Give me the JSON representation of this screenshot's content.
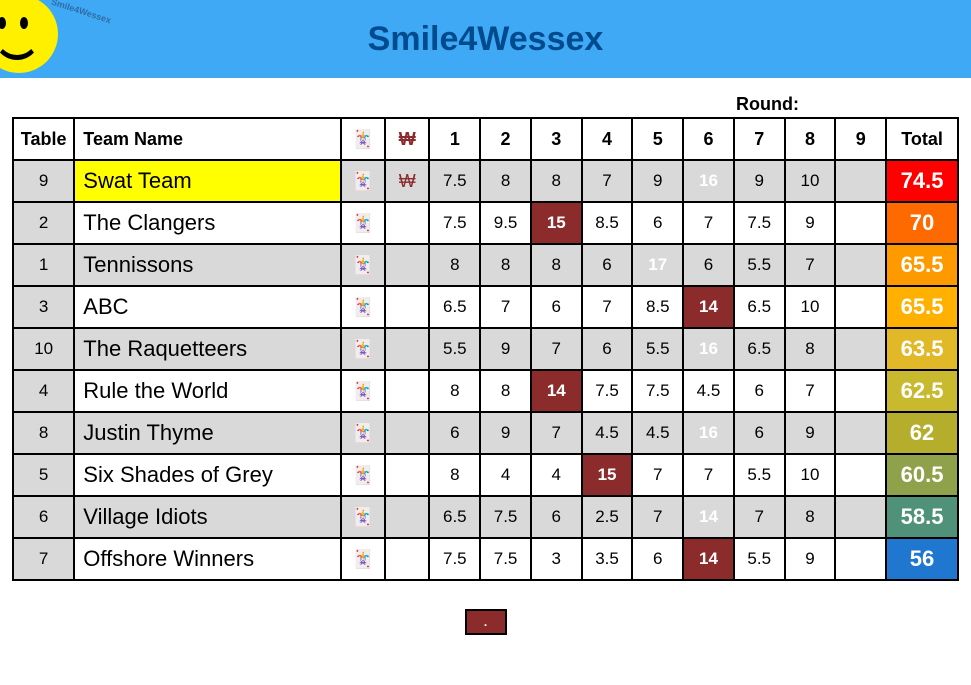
{
  "title": "Smile4Wessex",
  "logo_text": "Smile4Wessex",
  "round_label": "Round:",
  "joker_icon": "🃏",
  "wager_icon": "₩",
  "legend_text": ".",
  "headers": {
    "table": "Table",
    "name": "Team Name",
    "total": "Total"
  },
  "round_headers": [
    "1",
    "2",
    "3",
    "4",
    "5",
    "6",
    "7",
    "8",
    "9"
  ],
  "total_colors": [
    "#ff0000",
    "#ff6a00",
    "#ff9900",
    "#ffb000",
    "#e0b828",
    "#c9b92e",
    "#b5ad2c",
    "#8fa14a",
    "#4f9279",
    "#1f77d0"
  ],
  "rows": [
    {
      "table": "9",
      "name": "Swat Team",
      "wager": true,
      "joker_round": 6,
      "leader": true,
      "scores": [
        "7.5",
        "8",
        "8",
        "7",
        "9",
        "16",
        "9",
        "10",
        ""
      ],
      "total": "74.5"
    },
    {
      "table": "2",
      "name": "The Clangers",
      "wager": false,
      "joker_round": 3,
      "leader": false,
      "scores": [
        "7.5",
        "9.5",
        "15",
        "8.5",
        "6",
        "7",
        "7.5",
        "9",
        ""
      ],
      "total": "70"
    },
    {
      "table": "1",
      "name": "Tennissons",
      "wager": false,
      "joker_round": 5,
      "leader": false,
      "scores": [
        "8",
        "8",
        "8",
        "6",
        "17",
        "6",
        "5.5",
        "7",
        ""
      ],
      "total": "65.5"
    },
    {
      "table": "3",
      "name": "ABC",
      "wager": false,
      "joker_round": 6,
      "leader": false,
      "scores": [
        "6.5",
        "7",
        "6",
        "7",
        "8.5",
        "14",
        "6.5",
        "10",
        ""
      ],
      "total": "65.5"
    },
    {
      "table": "10",
      "name": "The Raquetteers",
      "wager": false,
      "joker_round": 6,
      "leader": false,
      "scores": [
        "5.5",
        "9",
        "7",
        "6",
        "5.5",
        "16",
        "6.5",
        "8",
        ""
      ],
      "total": "63.5"
    },
    {
      "table": "4",
      "name": "Rule the World",
      "wager": false,
      "joker_round": 3,
      "leader": false,
      "scores": [
        "8",
        "8",
        "14",
        "7.5",
        "7.5",
        "4.5",
        "6",
        "7",
        ""
      ],
      "total": "62.5"
    },
    {
      "table": "8",
      "name": "Justin Thyme",
      "wager": false,
      "joker_round": 6,
      "leader": false,
      "scores": [
        "6",
        "9",
        "7",
        "4.5",
        "4.5",
        "16",
        "6",
        "9",
        ""
      ],
      "total": "62"
    },
    {
      "table": "5",
      "name": "Six Shades of Grey",
      "wager": false,
      "joker_round": 4,
      "leader": false,
      "scores": [
        "8",
        "4",
        "4",
        "15",
        "7",
        "7",
        "5.5",
        "10",
        ""
      ],
      "total": "60.5"
    },
    {
      "table": "6",
      "name": "Village Idiots",
      "wager": false,
      "joker_round": 6,
      "leader": false,
      "scores": [
        "6.5",
        "7.5",
        "6",
        "2.5",
        "7",
        "14",
        "7",
        "8",
        ""
      ],
      "total": "58.5"
    },
    {
      "table": "7",
      "name": "Offshore Winners",
      "wager": false,
      "joker_round": 6,
      "leader": false,
      "scores": [
        "7.5",
        "7.5",
        "3",
        "3.5",
        "6",
        "14",
        "5.5",
        "9",
        ""
      ],
      "total": "56"
    }
  ],
  "chart_data": {
    "type": "table",
    "title": "Smile4Wessex",
    "round_label": "Round:",
    "columns": [
      "Table",
      "Team Name",
      "Joker",
      "Wager",
      "1",
      "2",
      "3",
      "4",
      "5",
      "6",
      "7",
      "8",
      "9",
      "Total"
    ],
    "rows": [
      {
        "table": 9,
        "team": "Swat Team",
        "joker_round": 6,
        "wager": true,
        "rounds": [
          7.5,
          8,
          8,
          7,
          9,
          16,
          9,
          10,
          null
        ],
        "total": 74.5
      },
      {
        "table": 2,
        "team": "The Clangers",
        "joker_round": 3,
        "wager": false,
        "rounds": [
          7.5,
          9.5,
          15,
          8.5,
          6,
          7,
          7.5,
          9,
          null
        ],
        "total": 70
      },
      {
        "table": 1,
        "team": "Tennissons",
        "joker_round": 5,
        "wager": false,
        "rounds": [
          8,
          8,
          8,
          6,
          17,
          6,
          5.5,
          7,
          null
        ],
        "total": 65.5
      },
      {
        "table": 3,
        "team": "ABC",
        "joker_round": 6,
        "wager": false,
        "rounds": [
          6.5,
          7,
          6,
          7,
          8.5,
          14,
          6.5,
          10,
          null
        ],
        "total": 65.5
      },
      {
        "table": 10,
        "team": "The Raquetteers",
        "joker_round": 6,
        "wager": false,
        "rounds": [
          5.5,
          9,
          7,
          6,
          5.5,
          16,
          6.5,
          8,
          null
        ],
        "total": 63.5
      },
      {
        "table": 4,
        "team": "Rule the World",
        "joker_round": 3,
        "wager": false,
        "rounds": [
          8,
          8,
          14,
          7.5,
          7.5,
          4.5,
          6,
          7,
          null
        ],
        "total": 62.5
      },
      {
        "table": 8,
        "team": "Justin Thyme",
        "joker_round": 6,
        "wager": false,
        "rounds": [
          6,
          9,
          7,
          4.5,
          4.5,
          16,
          6,
          9,
          null
        ],
        "total": 62
      },
      {
        "table": 5,
        "team": "Six Shades of Grey",
        "joker_round": 4,
        "wager": false,
        "rounds": [
          8,
          4,
          4,
          15,
          7,
          7,
          5.5,
          10,
          null
        ],
        "total": 60.5
      },
      {
        "table": 6,
        "team": "Village Idiots",
        "joker_round": 6,
        "wager": false,
        "rounds": [
          6.5,
          7.5,
          6,
          2.5,
          7,
          14,
          7,
          8,
          null
        ],
        "total": 58.5
      },
      {
        "table": 7,
        "team": "Offshore Winners",
        "joker_round": 6,
        "wager": false,
        "rounds": [
          7.5,
          7.5,
          3,
          3.5,
          6,
          14,
          5.5,
          9,
          null
        ],
        "total": 56
      }
    ]
  }
}
